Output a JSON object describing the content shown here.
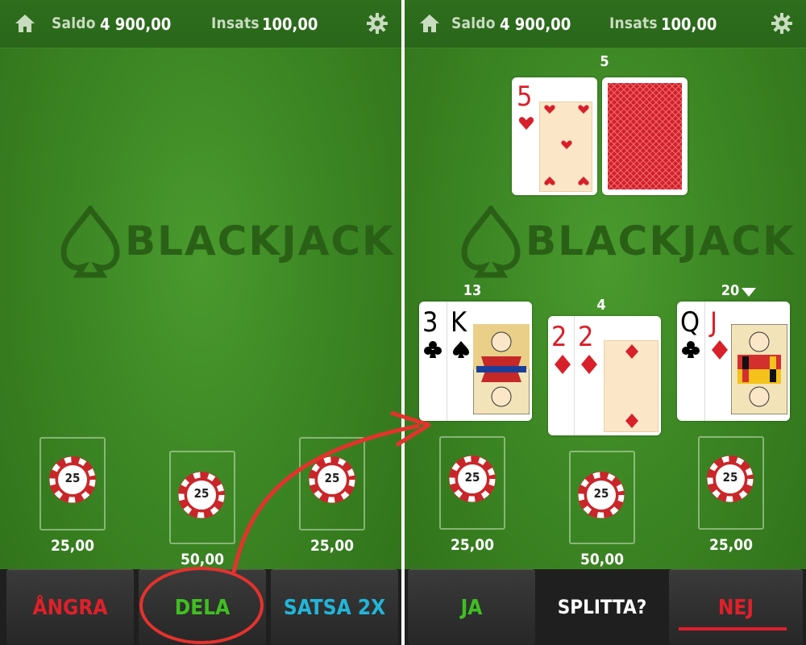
{
  "left": {
    "header": {
      "balance_label": "Saldo",
      "balance_value": "4 900,00",
      "bet_label": "Insats",
      "bet_value": "100,00"
    },
    "logo_text": "BLACKJACK",
    "spots": [
      {
        "chip": "25",
        "amount": "25,00"
      },
      {
        "chip": "25",
        "amount": "50,00"
      },
      {
        "chip": "25",
        "amount": "25,00"
      }
    ],
    "buttons": {
      "undo": "ÅNGRA",
      "deal": "DELA",
      "double": "SATSA 2X"
    },
    "colors": {
      "undo": "#e0202a",
      "deal": "#3fc021",
      "double": "#21b6d9",
      "highlight_circle": "#e5322d",
      "arrow": "#e5322d"
    }
  },
  "right": {
    "header": {
      "balance_label": "Saldo",
      "balance_value": "4 900,00",
      "bet_label": "Insats",
      "bet_value": "100,00"
    },
    "logo_text": "BLACKJACK",
    "dealer": {
      "score": "5",
      "cards": [
        "5",
        "back"
      ]
    },
    "hands": [
      {
        "score": "13",
        "cards": [
          "3",
          "K"
        ]
      },
      {
        "score": "4",
        "cards": [
          "2",
          "2"
        ]
      },
      {
        "score": "20",
        "cards": [
          "Q",
          "J"
        ]
      }
    ],
    "spots": [
      {
        "chip": "25",
        "amount": "25,00"
      },
      {
        "chip": "25",
        "amount": "50,00"
      },
      {
        "chip": "25",
        "amount": "25,00"
      }
    ],
    "prompt": {
      "yes": "JA",
      "question": "SPLITTA?",
      "no": "NEJ"
    },
    "colors": {
      "yes": "#3fc021",
      "no": "#e0202a",
      "question": "#ffffff"
    }
  }
}
